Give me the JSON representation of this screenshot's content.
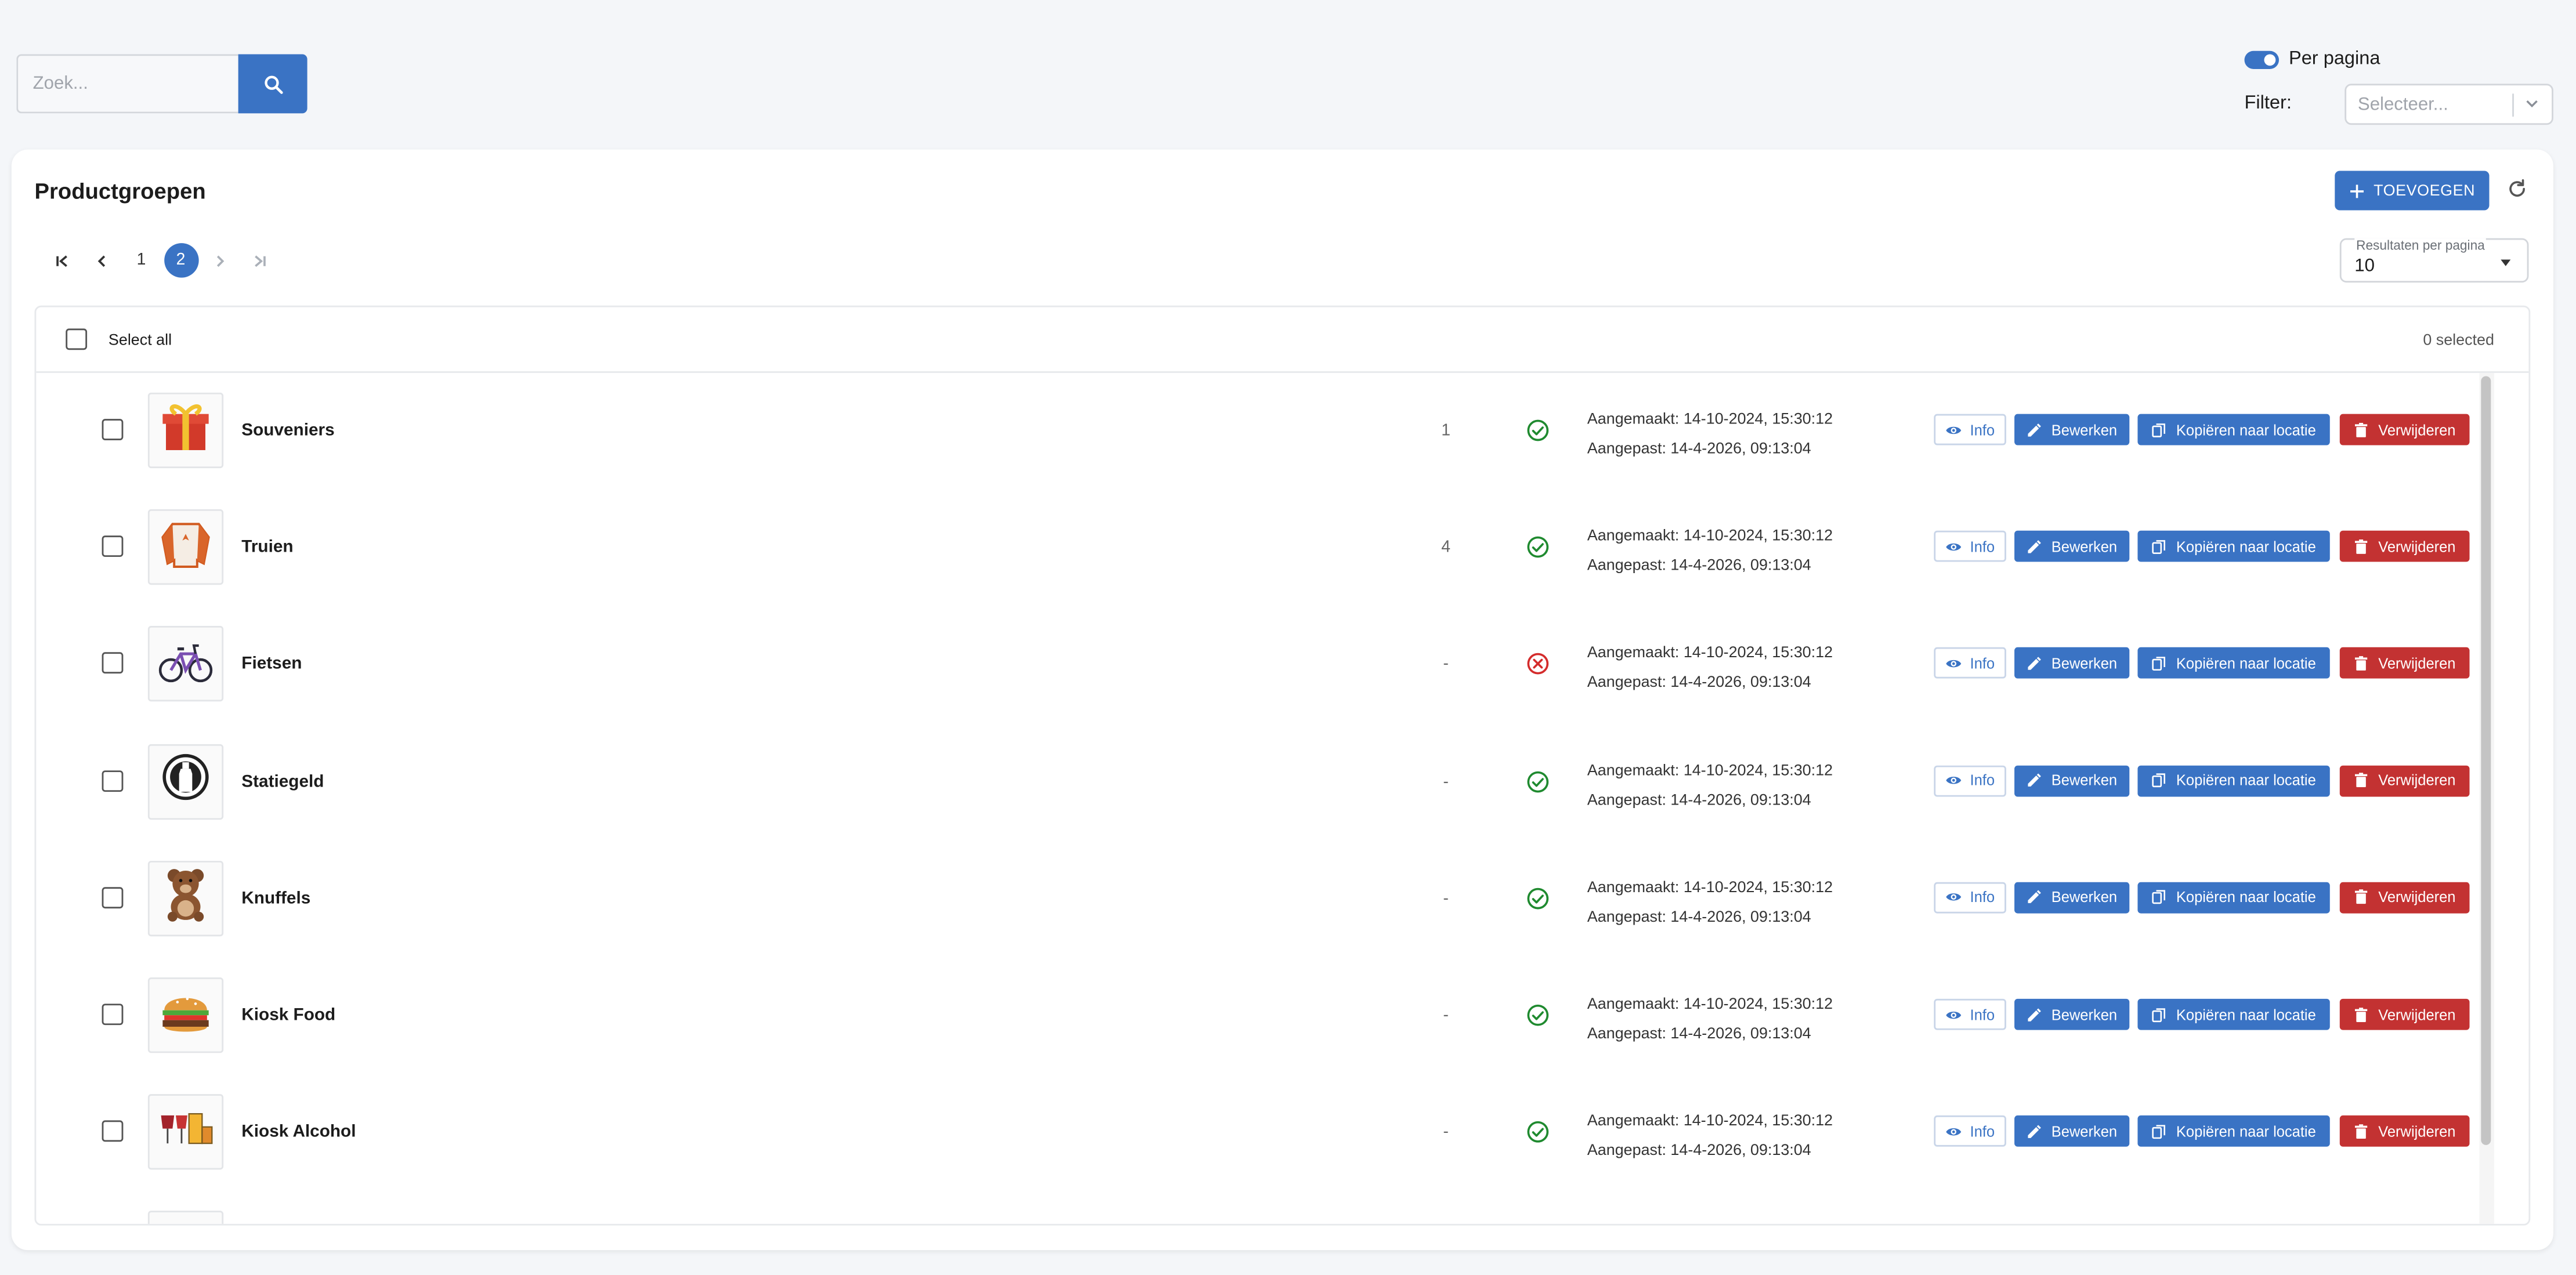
{
  "search": {
    "placeholder": "Zoek..."
  },
  "toggle": {
    "label": "Per pagina",
    "on": true
  },
  "filter": {
    "label": "Filter:",
    "placeholder": "Selecteer..."
  },
  "page": {
    "title": "Productgroepen",
    "add_label": "TOEVOEGEN"
  },
  "pagination": {
    "pages": [
      "1",
      "2"
    ],
    "current": "2"
  },
  "results_per_page": {
    "label": "Resultaten per pagina",
    "value": "10"
  },
  "table": {
    "select_all": "Select all",
    "selected_count": "0 selected",
    "actions": {
      "info": "Info",
      "edit": "Bewerken",
      "copy": "Kopiëren naar locatie",
      "delete": "Verwijderen"
    },
    "rows": [
      {
        "name": "Souveniers",
        "count": "1",
        "active": true,
        "created": "Aangemaakt: 14-10-2024, 15:30:12",
        "modified": "Aangepast: 14-4-2026, 09:13:04",
        "icon": "gift-icon"
      },
      {
        "name": "Truien",
        "count": "4",
        "active": true,
        "created": "Aangemaakt: 14-10-2024, 15:30:12",
        "modified": "Aangepast: 14-4-2026, 09:13:04",
        "icon": "sweater-icon"
      },
      {
        "name": "Fietsen",
        "count": "-",
        "active": false,
        "created": "Aangemaakt: 14-10-2024, 15:30:12",
        "modified": "Aangepast: 14-4-2026, 09:13:04",
        "icon": "bicycle-icon"
      },
      {
        "name": "Statiegeld",
        "count": "-",
        "active": true,
        "created": "Aangemaakt: 14-10-2024, 15:30:12",
        "modified": "Aangepast: 14-4-2026, 09:13:04",
        "icon": "deposit-bottle-icon"
      },
      {
        "name": "Knuffels",
        "count": "-",
        "active": true,
        "created": "Aangemaakt: 14-10-2024, 15:30:12",
        "modified": "Aangepast: 14-4-2026, 09:13:04",
        "icon": "teddy-bear-icon"
      },
      {
        "name": "Kiosk Food",
        "count": "-",
        "active": true,
        "created": "Aangemaakt: 14-10-2024, 15:30:12",
        "modified": "Aangepast: 14-4-2026, 09:13:04",
        "icon": "burger-icon"
      },
      {
        "name": "Kiosk Alcohol",
        "count": "-",
        "active": true,
        "created": "Aangemaakt: 14-10-2024, 15:30:12",
        "modified": "Aangepast: 14-4-2026, 09:13:04",
        "icon": "drinks-icon"
      }
    ]
  },
  "colors": {
    "primary": "#3a73c4",
    "danger": "#c33232",
    "success": "#1f8a2f",
    "error": "#d42c2c"
  }
}
